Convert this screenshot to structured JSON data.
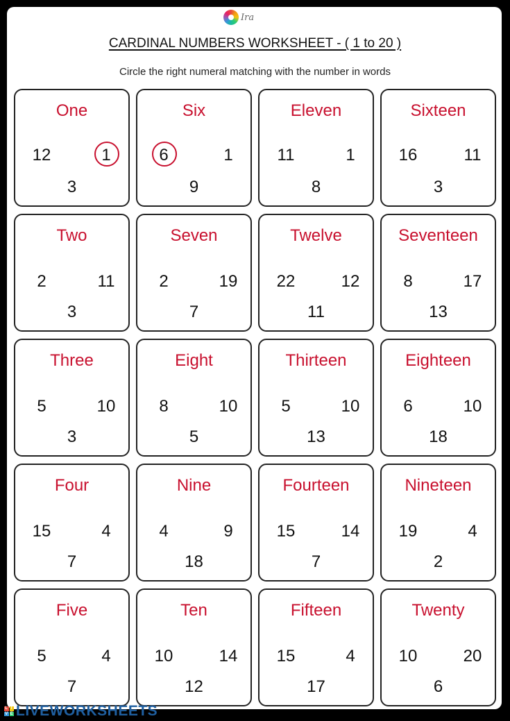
{
  "header": {
    "logo_icon": "color-wheel-logo-icon",
    "logo_text": "Ira",
    "title": "CARDINAL NUMBERS WORKSHEET - ( 1 to 20 )",
    "instruction": "Circle the right numeral matching with the number in words"
  },
  "colors": {
    "word": "#c8102e",
    "circle": "#c8102e",
    "numeral": "#111111",
    "border": "#222222",
    "brand": "#1f5fa0"
  },
  "cards": [
    {
      "word": "One",
      "left": "12",
      "right": "1",
      "bottom": "3",
      "circled": "right"
    },
    {
      "word": "Six",
      "left": "6",
      "right": "1",
      "bottom": "9",
      "circled": "left"
    },
    {
      "word": "Eleven",
      "left": "11",
      "right": "1",
      "bottom": "8",
      "circled": ""
    },
    {
      "word": "Sixteen",
      "left": "16",
      "right": "11",
      "bottom": "3",
      "circled": ""
    },
    {
      "word": "Two",
      "left": "2",
      "right": "11",
      "bottom": "3",
      "circled": ""
    },
    {
      "word": "Seven",
      "left": "2",
      "right": "19",
      "bottom": "7",
      "circled": ""
    },
    {
      "word": "Twelve",
      "left": "22",
      "right": "12",
      "bottom": "11",
      "circled": ""
    },
    {
      "word": "Seventeen",
      "left": "8",
      "right": "17",
      "bottom": "13",
      "circled": ""
    },
    {
      "word": "Three",
      "left": "5",
      "right": "10",
      "bottom": "3",
      "circled": ""
    },
    {
      "word": "Eight",
      "left": "8",
      "right": "10",
      "bottom": "5",
      "circled": ""
    },
    {
      "word": "Thirteen",
      "left": "5",
      "right": "10",
      "bottom": "13",
      "circled": ""
    },
    {
      "word": "Eighteen",
      "left": "6",
      "right": "10",
      "bottom": "18",
      "circled": ""
    },
    {
      "word": "Four",
      "left": "15",
      "right": "4",
      "bottom": "7",
      "circled": ""
    },
    {
      "word": "Nine",
      "left": "4",
      "right": "9",
      "bottom": "18",
      "circled": ""
    },
    {
      "word": "Fourteen",
      "left": "15",
      "right": "14",
      "bottom": "7",
      "circled": ""
    },
    {
      "word": "Nineteen",
      "left": "19",
      "right": "4",
      "bottom": "2",
      "circled": ""
    },
    {
      "word": "Five",
      "left": "5",
      "right": "4",
      "bottom": "7",
      "circled": ""
    },
    {
      "word": "Ten",
      "left": "10",
      "right": "14",
      "bottom": "12",
      "circled": ""
    },
    {
      "word": "Fifteen",
      "left": "15",
      "right": "4",
      "bottom": "17",
      "circled": ""
    },
    {
      "word": "Twenty",
      "left": "10",
      "right": "20",
      "bottom": "6",
      "circled": ""
    }
  ],
  "footer": {
    "brand_icon_letters": [
      "L",
      "I",
      "V",
      "E"
    ],
    "brand_text": "LIVEWORKSHEETS"
  }
}
